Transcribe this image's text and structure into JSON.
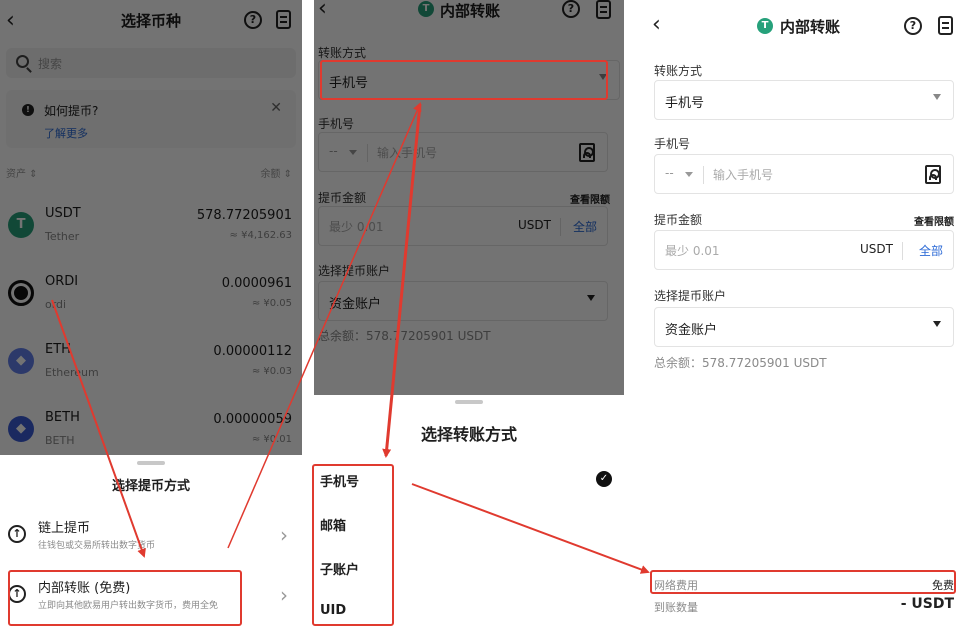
{
  "currency_select": {
    "title": "选择币种",
    "search_placeholder": "搜索",
    "tip_title": "如何提币?",
    "tip_link": "了解更多",
    "col_asset": "资产 ⇕",
    "col_balance": "余额 ⇕",
    "coins": [
      {
        "symbol": "USDT",
        "name": "Tether",
        "amount": "578.77205901",
        "fiat": "≈ ¥4,162.63"
      },
      {
        "symbol": "ORDI",
        "name": "ordi",
        "amount": "0.0000961",
        "fiat": "≈ ¥0.05"
      },
      {
        "symbol": "ETH",
        "name": "Ethereum",
        "amount": "0.00000112",
        "fiat": "≈ ¥0.03"
      },
      {
        "symbol": "BETH",
        "name": "BETH",
        "amount": "0.00000059",
        "fiat": "≈ ¥0.01"
      }
    ],
    "sheet_title": "选择提币方式",
    "methods": [
      {
        "title": "链上提币",
        "desc": "往钱包或交易所转出数字货币"
      },
      {
        "title": "内部转账 (免费)",
        "desc": "立即向其他欧易用户转出数字货币，费用全免"
      }
    ]
  },
  "transfer_form": {
    "title": "内部转账",
    "method_label": "转账方式",
    "method_value": "手机号",
    "phone_label": "手机号",
    "country_code": "--",
    "phone_placeholder": "输入手机号",
    "amount_label": "提币金额",
    "limits_link": "查看限额",
    "amount_placeholder": "最少 0.01",
    "unit": "USDT",
    "all": "全部",
    "account_label": "选择提币账户",
    "account_value": "资金账户",
    "balance_text": "总余额：578.77205901 USDT"
  },
  "transfer_sheet": {
    "title": "选择转账方式",
    "options": [
      "手机号",
      "邮箱",
      "子账户",
      "UID"
    ]
  },
  "fees": {
    "fee_label": "网络费用",
    "fee_value": "免费",
    "receive_label": "到账数量",
    "receive_value": "- USDT"
  },
  "colors": {
    "annotation_red": "#e03a2f",
    "tether_green": "#26a17b",
    "link_blue": "#2c6ad6"
  }
}
